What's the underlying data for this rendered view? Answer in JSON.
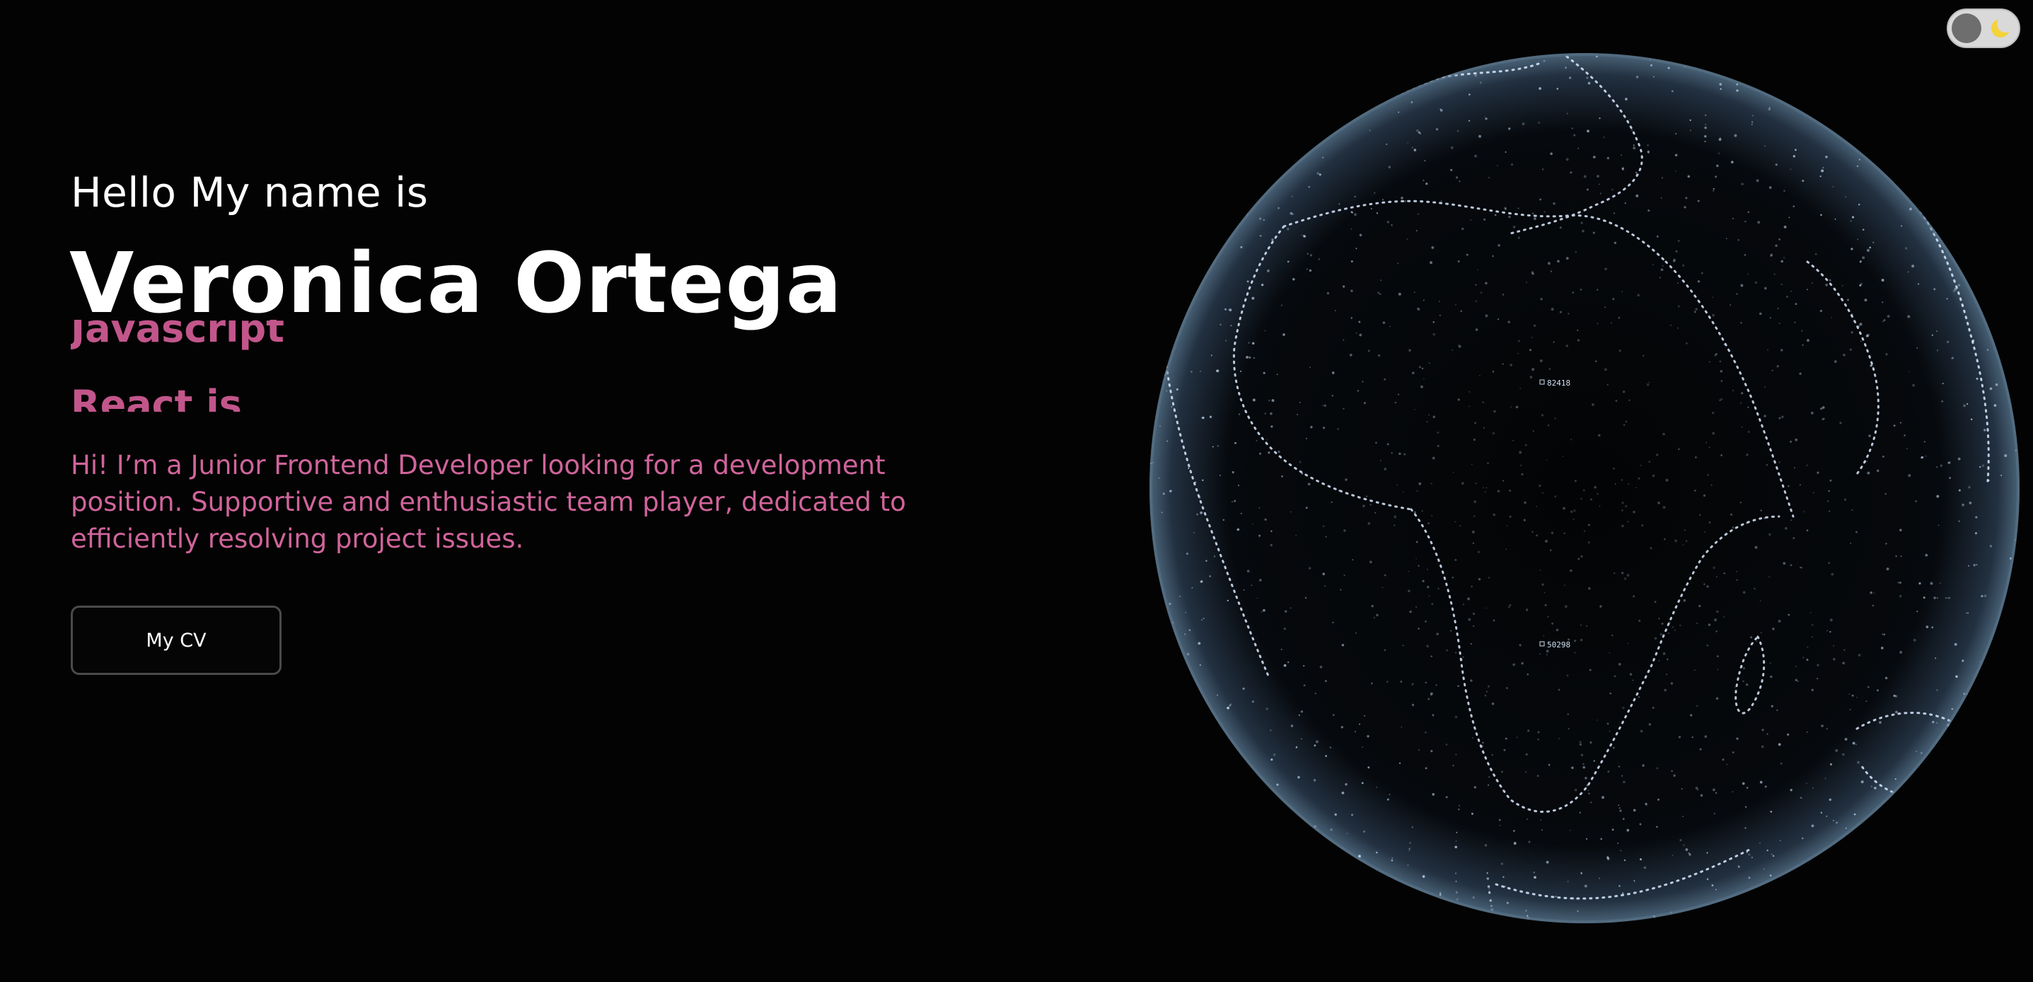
{
  "theme_toggle": {
    "icon": "moon-icon",
    "knob_color": "#6e6e6e",
    "track_color": "#d9d9d9",
    "moon_color": "#f3d23a"
  },
  "hero": {
    "greeting": "Hello My name is",
    "name": "Veronica Ortega",
    "skills": [
      "Javascript",
      "React js"
    ],
    "bio": "Hi! I’m a Junior Frontend Developer looking for a development position. Supportive and enthusiastic team player, dedicated to efficiently resolving project issues.",
    "cv_button_label": "My CV",
    "accent_color": "#c2568b"
  },
  "globe": {
    "labels": [
      "82418",
      "50298"
    ],
    "dot_color": "#cfe6ff"
  }
}
